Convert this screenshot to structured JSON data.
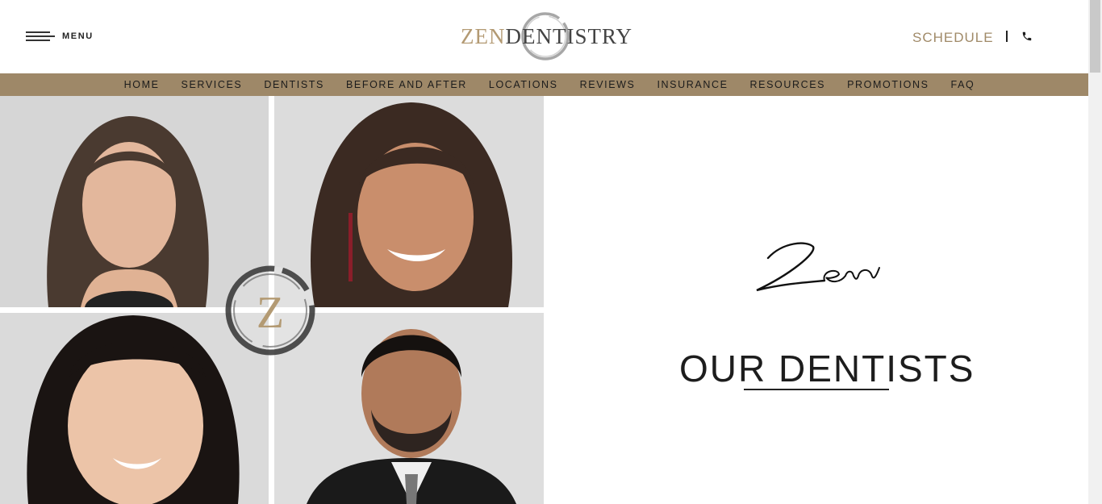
{
  "header": {
    "menu_label": "MENU",
    "logo_zen": "ZEN",
    "logo_dentistry": "DENTISTRY",
    "schedule_label": "SCHEDULE"
  },
  "nav": {
    "items": [
      {
        "label": "HOME"
      },
      {
        "label": "SERVICES"
      },
      {
        "label": "DENTISTS"
      },
      {
        "label": "BEFORE AND AFTER"
      },
      {
        "label": "LOCATIONS"
      },
      {
        "label": "REVIEWS"
      },
      {
        "label": "INSURANCE"
      },
      {
        "label": "RESOURCES"
      },
      {
        "label": "PROMOTIONS"
      },
      {
        "label": "FAQ"
      }
    ]
  },
  "hero": {
    "script_text": "Zen",
    "badge_letter": "Z",
    "title": "OUR DENTISTS"
  },
  "colors": {
    "brand_gold": "#9e8868",
    "logo_gold": "#b39a73",
    "text_dark": "#1d1d1d"
  },
  "icons": {
    "menu": "hamburger-icon",
    "phone": "phone-icon"
  }
}
